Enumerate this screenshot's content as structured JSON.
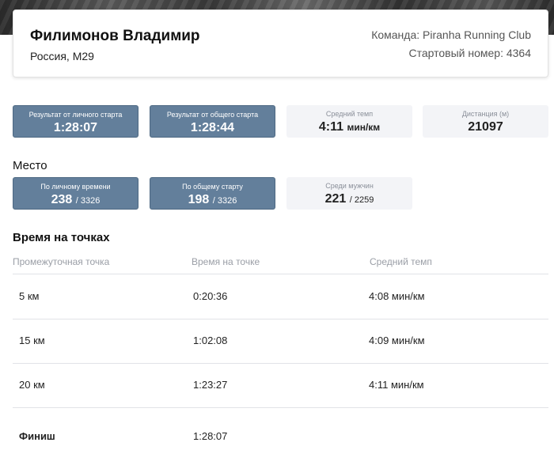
{
  "athlete": {
    "name": "Филимонов Владимир",
    "country_group": "Россия, М29",
    "team": "Команда: Piranha Running Club",
    "bib": "Стартовый номер: 4364"
  },
  "results": {
    "chip_label": "Результат от личного старта",
    "chip_time": "1:28:07",
    "gun_label": "Результат от общего старта",
    "gun_time": "1:28:44",
    "pace_label": "Средний темп",
    "pace_value": "4:11",
    "pace_unit": "мин/км",
    "distance_label": "Дистанция (м)",
    "distance_value": "21097"
  },
  "place": {
    "heading": "Место",
    "chip_label": "По личному времени",
    "chip_place": "238",
    "chip_total": "/ 3326",
    "gun_label": "По общему старту",
    "gun_place": "198",
    "gun_total": "/ 3326",
    "gender_label": "Среди мужчин",
    "gender_place": "221",
    "gender_total": "/ 2259"
  },
  "splits": {
    "heading": "Время на точках",
    "columns": [
      "Промежуточная точка",
      "Время на точке",
      "Средний темп"
    ],
    "rows": [
      {
        "point": "5 км",
        "time": "0:20:36",
        "pace": "4:08 мин/км"
      },
      {
        "point": "15 км",
        "time": "1:02:08",
        "pace": "4:09 мин/км"
      },
      {
        "point": "20 км",
        "time": "1:23:27",
        "pace": "4:11 мин/км"
      },
      {
        "point": "Финиш",
        "time": "1:28:07",
        "pace": ""
      }
    ]
  },
  "colors": {
    "tile_dark": "#637f9b",
    "tile_light": "#f3f4f7"
  }
}
